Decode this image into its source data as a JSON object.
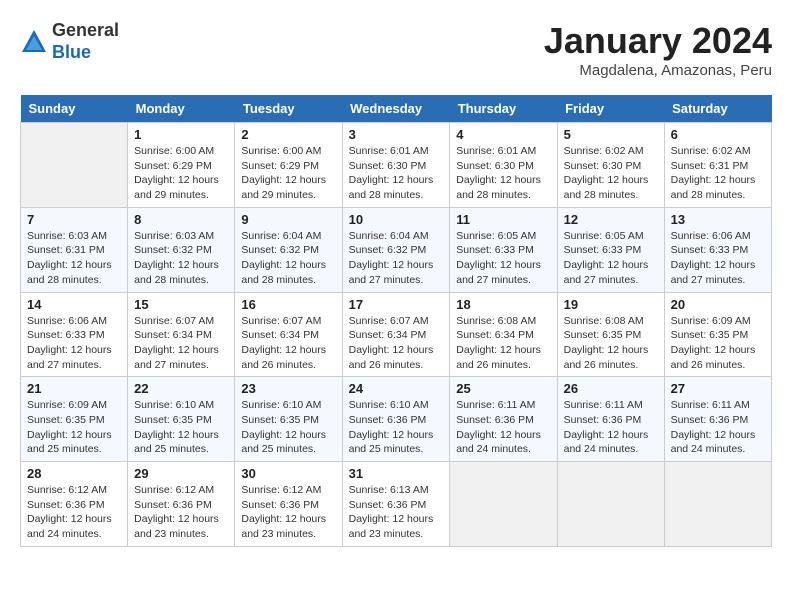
{
  "header": {
    "logo_general": "General",
    "logo_blue": "Blue",
    "month_title": "January 2024",
    "location": "Magdalena, Amazonas, Peru"
  },
  "days_of_week": [
    "Sunday",
    "Monday",
    "Tuesday",
    "Wednesday",
    "Thursday",
    "Friday",
    "Saturday"
  ],
  "weeks": [
    [
      {
        "day": "",
        "info": ""
      },
      {
        "day": "1",
        "info": "Sunrise: 6:00 AM\nSunset: 6:29 PM\nDaylight: 12 hours\nand 29 minutes."
      },
      {
        "day": "2",
        "info": "Sunrise: 6:00 AM\nSunset: 6:29 PM\nDaylight: 12 hours\nand 29 minutes."
      },
      {
        "day": "3",
        "info": "Sunrise: 6:01 AM\nSunset: 6:30 PM\nDaylight: 12 hours\nand 28 minutes."
      },
      {
        "day": "4",
        "info": "Sunrise: 6:01 AM\nSunset: 6:30 PM\nDaylight: 12 hours\nand 28 minutes."
      },
      {
        "day": "5",
        "info": "Sunrise: 6:02 AM\nSunset: 6:30 PM\nDaylight: 12 hours\nand 28 minutes."
      },
      {
        "day": "6",
        "info": "Sunrise: 6:02 AM\nSunset: 6:31 PM\nDaylight: 12 hours\nand 28 minutes."
      }
    ],
    [
      {
        "day": "7",
        "info": "Sunrise: 6:03 AM\nSunset: 6:31 PM\nDaylight: 12 hours\nand 28 minutes."
      },
      {
        "day": "8",
        "info": "Sunrise: 6:03 AM\nSunset: 6:32 PM\nDaylight: 12 hours\nand 28 minutes."
      },
      {
        "day": "9",
        "info": "Sunrise: 6:04 AM\nSunset: 6:32 PM\nDaylight: 12 hours\nand 28 minutes."
      },
      {
        "day": "10",
        "info": "Sunrise: 6:04 AM\nSunset: 6:32 PM\nDaylight: 12 hours\nand 27 minutes."
      },
      {
        "day": "11",
        "info": "Sunrise: 6:05 AM\nSunset: 6:33 PM\nDaylight: 12 hours\nand 27 minutes."
      },
      {
        "day": "12",
        "info": "Sunrise: 6:05 AM\nSunset: 6:33 PM\nDaylight: 12 hours\nand 27 minutes."
      },
      {
        "day": "13",
        "info": "Sunrise: 6:06 AM\nSunset: 6:33 PM\nDaylight: 12 hours\nand 27 minutes."
      }
    ],
    [
      {
        "day": "14",
        "info": "Sunrise: 6:06 AM\nSunset: 6:33 PM\nDaylight: 12 hours\nand 27 minutes."
      },
      {
        "day": "15",
        "info": "Sunrise: 6:07 AM\nSunset: 6:34 PM\nDaylight: 12 hours\nand 27 minutes."
      },
      {
        "day": "16",
        "info": "Sunrise: 6:07 AM\nSunset: 6:34 PM\nDaylight: 12 hours\nand 26 minutes."
      },
      {
        "day": "17",
        "info": "Sunrise: 6:07 AM\nSunset: 6:34 PM\nDaylight: 12 hours\nand 26 minutes."
      },
      {
        "day": "18",
        "info": "Sunrise: 6:08 AM\nSunset: 6:34 PM\nDaylight: 12 hours\nand 26 minutes."
      },
      {
        "day": "19",
        "info": "Sunrise: 6:08 AM\nSunset: 6:35 PM\nDaylight: 12 hours\nand 26 minutes."
      },
      {
        "day": "20",
        "info": "Sunrise: 6:09 AM\nSunset: 6:35 PM\nDaylight: 12 hours\nand 26 minutes."
      }
    ],
    [
      {
        "day": "21",
        "info": "Sunrise: 6:09 AM\nSunset: 6:35 PM\nDaylight: 12 hours\nand 25 minutes."
      },
      {
        "day": "22",
        "info": "Sunrise: 6:10 AM\nSunset: 6:35 PM\nDaylight: 12 hours\nand 25 minutes."
      },
      {
        "day": "23",
        "info": "Sunrise: 6:10 AM\nSunset: 6:35 PM\nDaylight: 12 hours\nand 25 minutes."
      },
      {
        "day": "24",
        "info": "Sunrise: 6:10 AM\nSunset: 6:36 PM\nDaylight: 12 hours\nand 25 minutes."
      },
      {
        "day": "25",
        "info": "Sunrise: 6:11 AM\nSunset: 6:36 PM\nDaylight: 12 hours\nand 24 minutes."
      },
      {
        "day": "26",
        "info": "Sunrise: 6:11 AM\nSunset: 6:36 PM\nDaylight: 12 hours\nand 24 minutes."
      },
      {
        "day": "27",
        "info": "Sunrise: 6:11 AM\nSunset: 6:36 PM\nDaylight: 12 hours\nand 24 minutes."
      }
    ],
    [
      {
        "day": "28",
        "info": "Sunrise: 6:12 AM\nSunset: 6:36 PM\nDaylight: 12 hours\nand 24 minutes."
      },
      {
        "day": "29",
        "info": "Sunrise: 6:12 AM\nSunset: 6:36 PM\nDaylight: 12 hours\nand 23 minutes."
      },
      {
        "day": "30",
        "info": "Sunrise: 6:12 AM\nSunset: 6:36 PM\nDaylight: 12 hours\nand 23 minutes."
      },
      {
        "day": "31",
        "info": "Sunrise: 6:13 AM\nSunset: 6:36 PM\nDaylight: 12 hours\nand 23 minutes."
      },
      {
        "day": "",
        "info": ""
      },
      {
        "day": "",
        "info": ""
      },
      {
        "day": "",
        "info": ""
      }
    ]
  ]
}
